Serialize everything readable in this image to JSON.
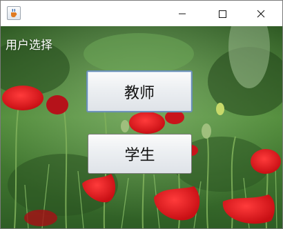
{
  "window": {
    "app_icon": "java-cup-icon",
    "controls": {
      "minimize": "minimize-icon",
      "maximize": "maximize-icon",
      "close": "close-icon"
    }
  },
  "main": {
    "hint_label": "用户选择",
    "buttons": [
      {
        "label": "教师",
        "focused": true
      },
      {
        "label": "学生",
        "focused": false
      }
    ]
  },
  "colors": {
    "poppy_red": "#e0161c",
    "foliage_green": "#3f7a2e",
    "focus_border": "#6a8fb5"
  }
}
